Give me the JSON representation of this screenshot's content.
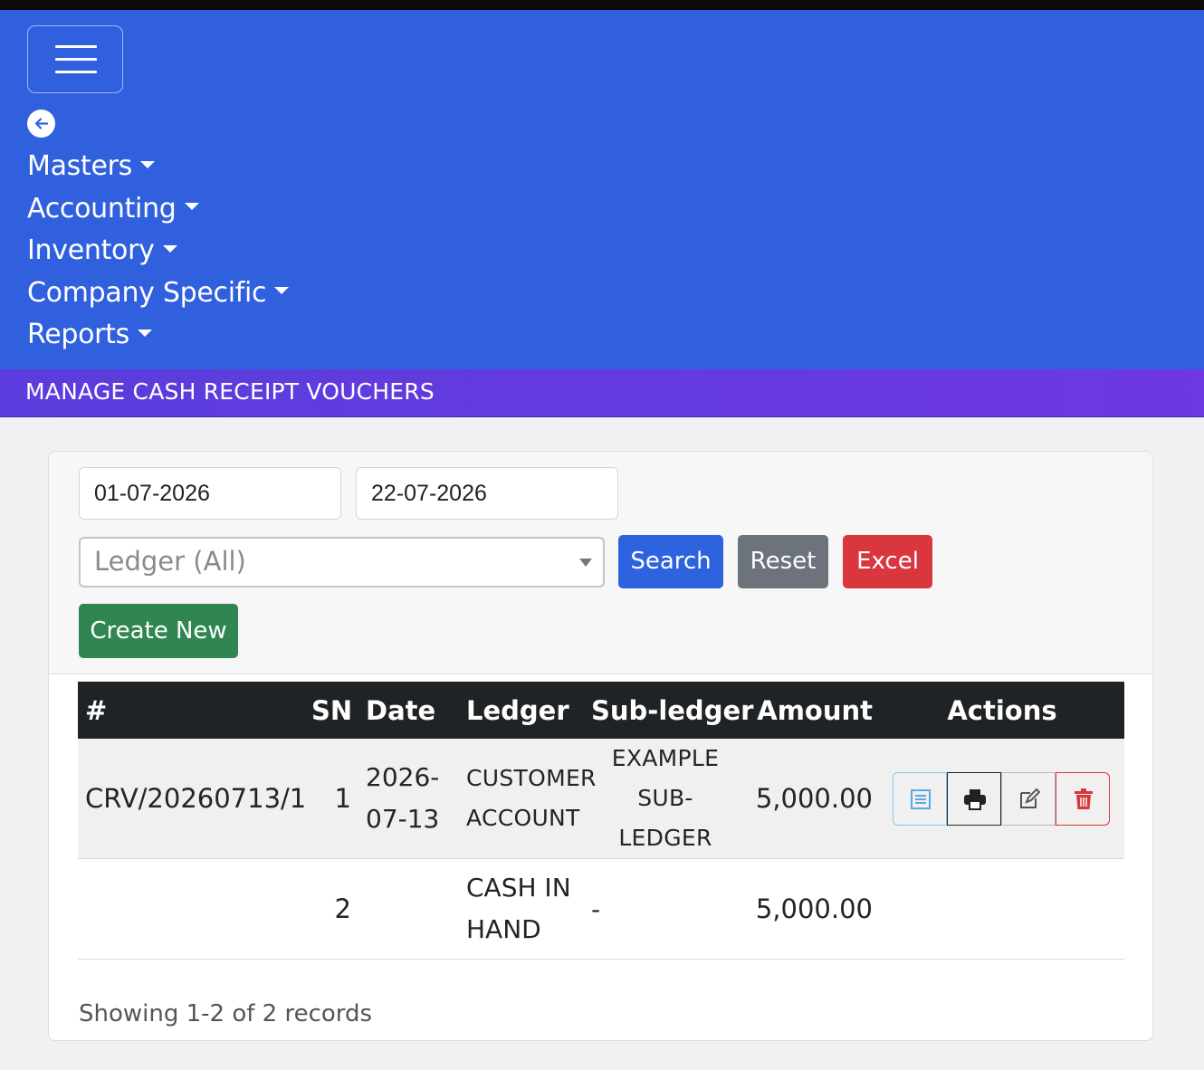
{
  "nav": {
    "menu": [
      {
        "label": "Masters"
      },
      {
        "label": "Accounting"
      },
      {
        "label": "Inventory"
      },
      {
        "label": "Company Specific"
      },
      {
        "label": "Reports"
      }
    ]
  },
  "page": {
    "title": "MANAGE CASH RECEIPT VOUCHERS"
  },
  "filters": {
    "from_date": "01-07-2026",
    "to_date": "22-07-2026",
    "ledger_selected": "Ledger (All)",
    "search_label": "Search",
    "reset_label": "Reset",
    "excel_label": "Excel",
    "create_label": "Create New"
  },
  "table": {
    "headers": [
      "#",
      "SN",
      "Date",
      "Ledger",
      "Sub-ledger",
      "Amount",
      "Actions"
    ],
    "rows": [
      {
        "voucher": "CRV/20260713/1",
        "sn": "1",
        "date_line1": "2026-",
        "date_line2": "07-13",
        "ledger_line1": "CUSTOMER",
        "ledger_line2": "ACCOUNT",
        "subledger_line1": "EXAMPLE",
        "subledger_line2": "SUB-LEDGER",
        "amount": "5,000.00"
      },
      {
        "voucher": "",
        "sn": "2",
        "date_line1": "",
        "date_line2": "",
        "ledger_line1": "CASH IN",
        "ledger_line2": "HAND",
        "subledger_line1": "-",
        "subledger_line2": "",
        "amount": "5,000.00"
      }
    ]
  },
  "pagination": {
    "summary": "Showing 1-2 of 2 records"
  },
  "colors": {
    "navbar": "#3160df",
    "titlebar": "#6237e0",
    "search": "#2e63e0",
    "reset": "#6c737a",
    "excel": "#d9363e",
    "create": "#2f8650",
    "table_header": "#202326"
  },
  "icons": [
    "hamburger-icon",
    "back-arrow-icon",
    "chevron-down-icon",
    "view-icon",
    "print-icon",
    "edit-icon",
    "trash-icon"
  ]
}
